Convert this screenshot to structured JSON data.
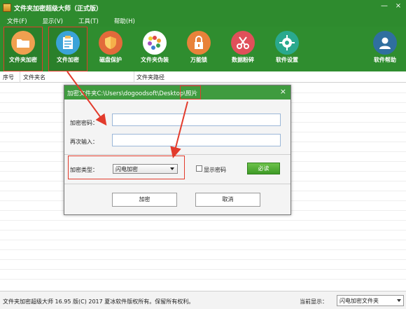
{
  "window": {
    "title": "文件夹加密超级大师（正式版）",
    "min_glyph": "—",
    "close_glyph": "×"
  },
  "menu": [
    "文件(F)",
    "显示(V)",
    "工具(T)",
    "帮助(H)"
  ],
  "toolbar": [
    {
      "label": "文件夹加密",
      "icon": "folder-icon",
      "color": "#f0a050",
      "selected": true
    },
    {
      "label": "文件加密",
      "icon": "document-icon",
      "color": "#3aa3d8",
      "selected": true
    },
    {
      "label": "磁盘保护",
      "icon": "shield-icon",
      "color": "#e26a3b",
      "selected": false
    },
    {
      "label": "文件夹伪装",
      "icon": "palette-icon",
      "color": "#ffffff",
      "selected": false
    },
    {
      "label": "万能锁",
      "icon": "padlock-icon",
      "color": "#e8823a",
      "selected": false
    },
    {
      "label": "数据粉碎",
      "icon": "scissors-icon",
      "color": "#e0505a",
      "selected": false
    },
    {
      "label": "软件设置",
      "icon": "gear-icon",
      "color": "#2aa98e",
      "selected": false
    },
    {
      "label": "软件帮助",
      "icon": "user-icon",
      "color": "#2f6f9f",
      "selected": false
    }
  ],
  "table": {
    "columns": [
      "序号",
      "文件夹名",
      "文件夹路径"
    ]
  },
  "dialog": {
    "title": "加密文件夹C:\\Users\\dogoodsoft\\Desktop\\照片",
    "password_label": "加密密码：",
    "password_value": "",
    "confirm_label": "再次输入：",
    "confirm_value": "",
    "type_label": "加密类型：",
    "type_value": "闪电加密",
    "show_password_label": "显示密码",
    "show_password_checked": false,
    "must_read": "必读",
    "encrypt_button": "加密",
    "cancel_button": "取消",
    "close_glyph": "×"
  },
  "status": {
    "text": "文件夹加密超级大师 16.95 版(C) 2017  夏冰软件版权所有。保留所有权利。",
    "view_label": "当前显示：",
    "view_value": "闪电加密文件夹"
  },
  "colors": {
    "brand_green": "#2e8b2e",
    "annotation_red": "#e23b2c"
  }
}
